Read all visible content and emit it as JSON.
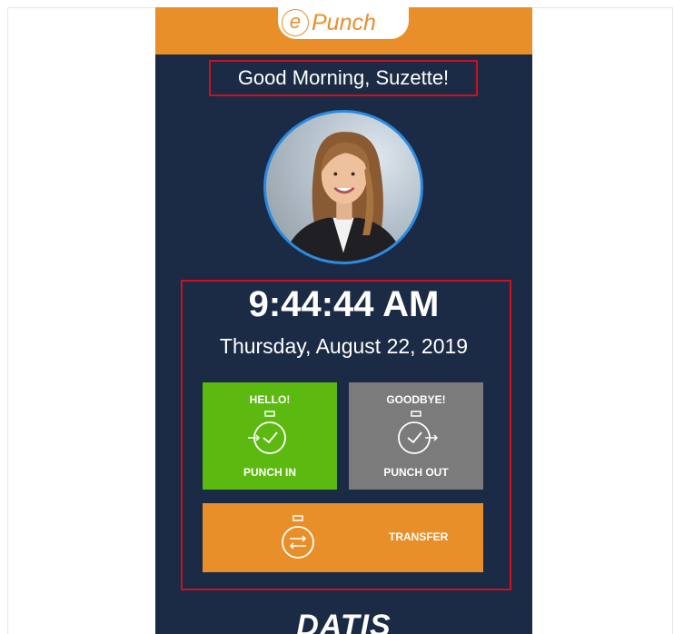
{
  "header": {
    "logo_letter": "e",
    "logo_text": "Punch"
  },
  "greeting": "Good Morning, Suzette!",
  "clock": {
    "time": "9:44:44 AM",
    "date": "Thursday, August 22, 2019"
  },
  "actions": {
    "punch_in": {
      "top": "HELLO!",
      "bottom": "PUNCH IN",
      "icon": "stopwatch-arrow-in-icon"
    },
    "punch_out": {
      "top": "GOODBYE!",
      "bottom": "PUNCH OUT",
      "icon": "stopwatch-arrow-out-icon"
    },
    "transfer": {
      "label": "TRANSFER",
      "icon": "stopwatch-transfer-icon"
    }
  },
  "footer": {
    "brand": "DATIS"
  },
  "colors": {
    "background": "#1b2a45",
    "accent_orange": "#e88f2a",
    "punch_in_green": "#5cb90f",
    "punch_out_gray": "#7b7b7b",
    "highlight_red": "#d0101c",
    "avatar_ring": "#2b8be0"
  }
}
